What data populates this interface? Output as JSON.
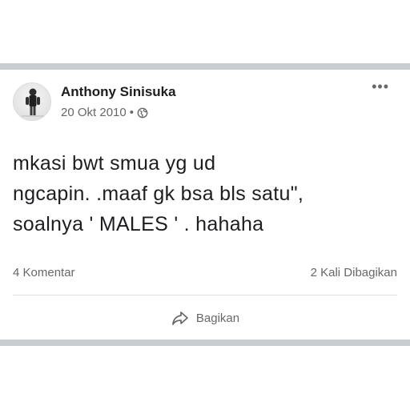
{
  "post": {
    "author": "Anthony Sinisuka",
    "date": "20 Okt 2010",
    "separator": "•",
    "privacy_icon": "globe-icon",
    "more_icon": "more-options-icon",
    "more_label": "•••",
    "text": "mkasi bwt smua yg ud\nngcapin. .maaf gk bsa bls satu\",\nsoalnya ' MALES ' .  hahaha",
    "comments": "4 Komentar",
    "shares": "2 Kali Dibagikan",
    "share_label": "Bagikan",
    "share_icon": "share-arrow-icon"
  },
  "colors": {
    "text_primary": "#1c1e21",
    "text_secondary": "#65676b",
    "separator_band": "#c9ccd1",
    "divider": "#dddfe2"
  }
}
